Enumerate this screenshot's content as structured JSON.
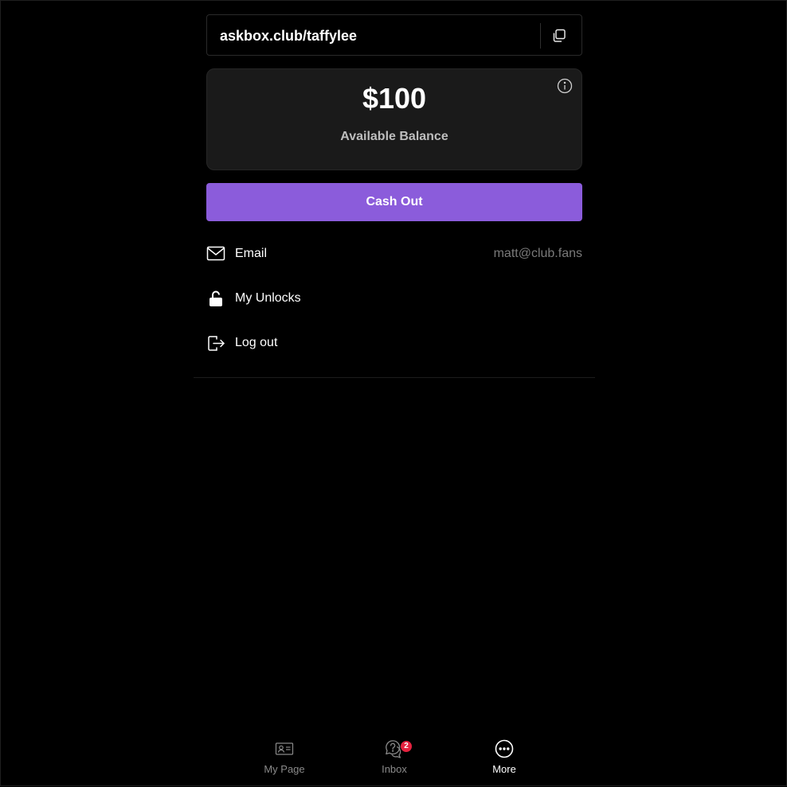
{
  "profile_link": {
    "url_text": "askbox.club/taffylee",
    "copy_icon": "copy-icon"
  },
  "balance": {
    "amount": "$100",
    "label": "Available Balance",
    "info_icon": "info-icon"
  },
  "actions": {
    "cash_out_label": "Cash Out"
  },
  "menu": {
    "items": [
      {
        "icon": "mail-icon",
        "label": "Email",
        "value": "matt@club.fans"
      },
      {
        "icon": "unlock-icon",
        "label": "My Unlocks"
      },
      {
        "icon": "logout-icon",
        "label": "Log out"
      }
    ]
  },
  "bottom_nav": {
    "items": [
      {
        "icon": "profile-card-icon",
        "label": "My Page"
      },
      {
        "icon": "question-chat-icon",
        "label": "Inbox",
        "badge": "2"
      },
      {
        "icon": "more-icon",
        "label": "More",
        "active": true
      }
    ]
  },
  "colors": {
    "accent": "#8b5cdb",
    "background": "#000000",
    "card": "#1a1a1a",
    "badge": "#e5223f",
    "muted_text": "#7a7a7a"
  }
}
